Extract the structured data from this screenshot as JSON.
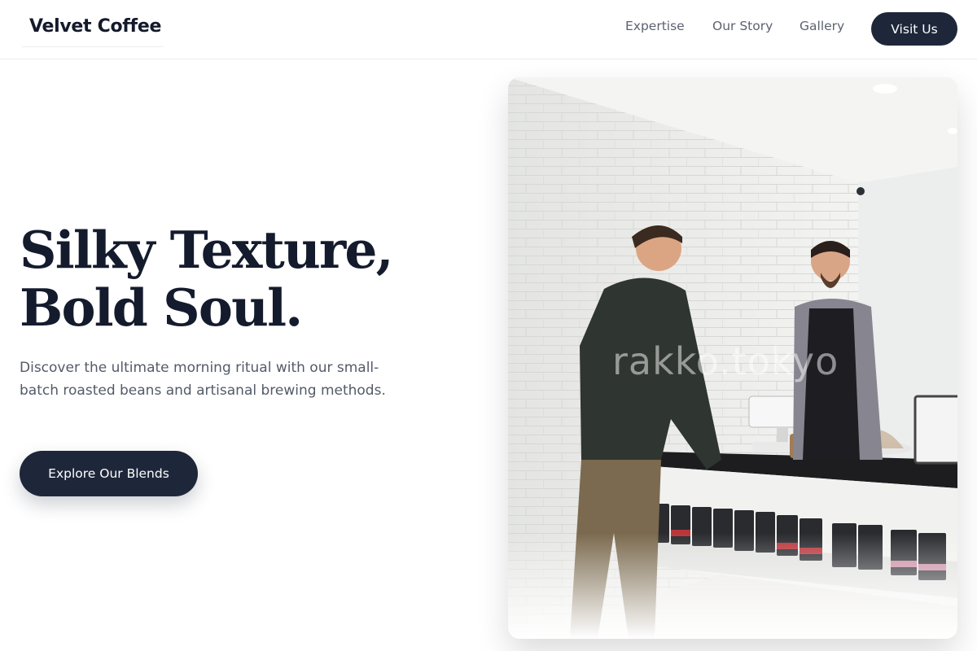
{
  "header": {
    "brand": "Velvet Coffee",
    "nav": [
      "Expertise",
      "Our Story",
      "Gallery"
    ],
    "cta_label": "Visit Us"
  },
  "hero": {
    "title_line1": "Silky Texture,",
    "title_line2": "Bold Soul.",
    "subtitle": "Discover the ultimate morning ritual with our small-batch roasted beans and artisanal brewing methods.",
    "cta_label": "Explore Our Blends"
  },
  "image": {
    "watermark": "rakko.tokyo"
  },
  "colors": {
    "primary": "#1e273a",
    "heading": "#141b2d",
    "body_text": "#535a68",
    "nav_text": "#5b6270"
  }
}
